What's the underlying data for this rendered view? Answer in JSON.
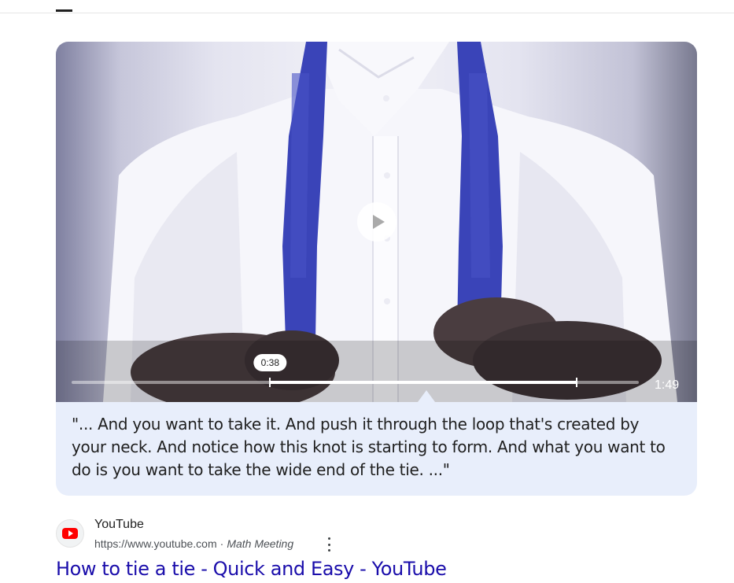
{
  "video": {
    "tooltip_time": "0:38",
    "duration": "1:49",
    "seek": {
      "highlight_start_fraction": 0.35,
      "highlight_end_fraction": 0.89,
      "current_fraction": 0.35
    }
  },
  "transcript": {
    "text": "\"... And you want to take it. And push it through the loop that's created by your neck. And notice how this knot is starting to form. And what you want to do is you want to take the wide end of the tie. ...\""
  },
  "result": {
    "source_name": "YouTube",
    "url": "https://www.youtube.com",
    "separator": "·",
    "author": "Math Meeting",
    "title": "How to tie a tie - Quick and Easy - YouTube"
  },
  "colors": {
    "link": "#1a0dab",
    "caption_bg": "#e8eefb",
    "tie": "#3a44b8",
    "brand": "#ff0000"
  },
  "icons": {
    "play": "play-icon",
    "source": "youtube-logo-icon",
    "more": "more-vert-icon"
  }
}
